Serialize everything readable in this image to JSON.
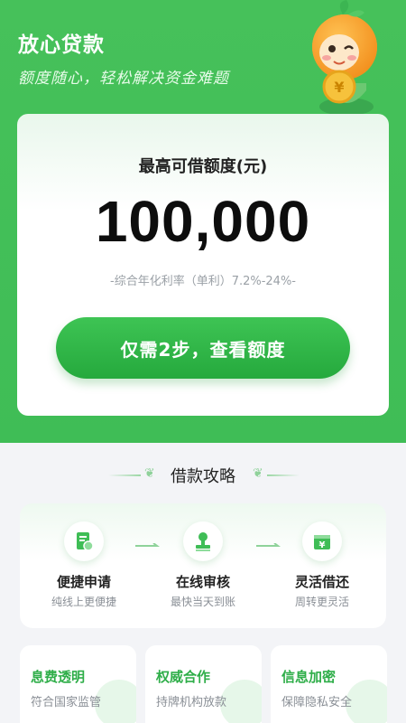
{
  "header": {
    "title": "放心贷款",
    "subtitle": "额度随心，轻松解决资金难题"
  },
  "card": {
    "label": "最高可借额度(元)",
    "amount": "100,000",
    "rate": "-综合年化利率（单利）7.2%-24%-",
    "cta": "仅需2步，查看额度"
  },
  "section": {
    "title": "借款攻略"
  },
  "steps": [
    {
      "title": "便捷申请",
      "sub": "纯线上更便捷",
      "icon": "document-icon"
    },
    {
      "title": "在线审核",
      "sub": "最快当天到账",
      "icon": "stamp-icon"
    },
    {
      "title": "灵活借还",
      "sub": "周转更灵活",
      "icon": "yuan-wallet-icon"
    }
  ],
  "features": [
    {
      "title": "息费透明",
      "sub": "符合国家监管"
    },
    {
      "title": "权威合作",
      "sub": "持牌机构放款"
    },
    {
      "title": "信息加密",
      "sub": "保障隐私安全"
    }
  ],
  "colors": {
    "brand_green": "#3fbd56",
    "button_green": "#2db044",
    "feature_title": "#2fae49"
  }
}
